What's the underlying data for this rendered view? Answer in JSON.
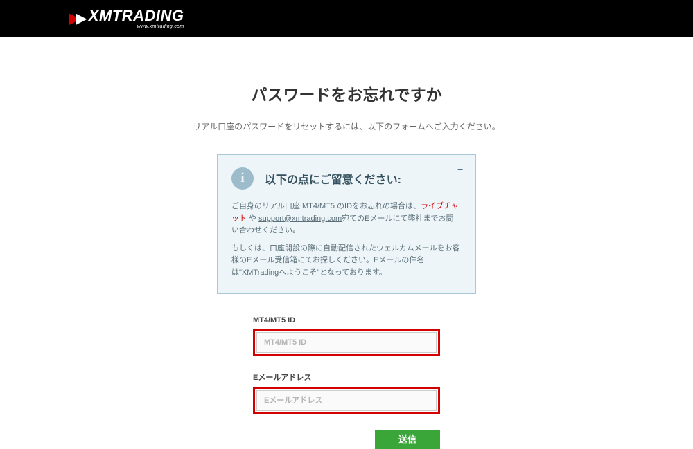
{
  "header": {
    "logo_text": "XMTRADING",
    "logo_subtext": "www.xmtrading.com"
  },
  "page": {
    "title": "パスワードをお忘れですか",
    "subtitle": "リアル口座のパスワードをリセットするには、以下のフォームへご入力ください。"
  },
  "info": {
    "title": "以下の点にご留意ください:",
    "text1_prefix": "ご自身のリアル口座 MT4/MT5 のIDをお忘れの場合は、",
    "live_chat": "ライブチャット",
    "text1_mid": " や ",
    "support_email": "support@xmtrading.com",
    "text1_suffix": "宛てのEメールにて弊社までお問い合わせください。",
    "text2": "もしくは、口座開設の際に自動配信されたウェルカムメールをお客様のEメール受信箱にてお探しください。Eメールの件名は\"XMTradingへようこそ\"となっております。"
  },
  "form": {
    "id_label": "MT4/MT5 ID",
    "id_placeholder": "MT4/MT5 ID",
    "email_label": "Eメールアドレス",
    "email_placeholder": "Eメールアドレス",
    "submit_label": "送信"
  }
}
